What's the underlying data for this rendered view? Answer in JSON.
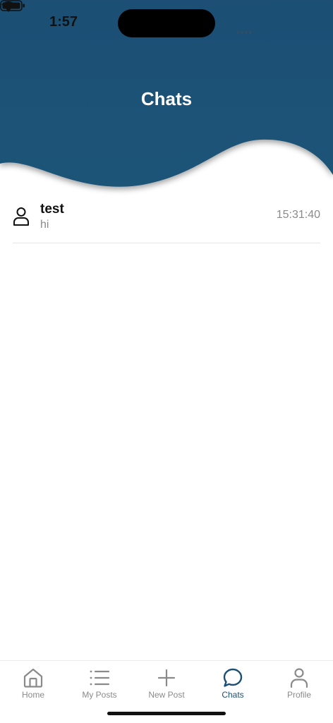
{
  "status_bar": {
    "time": "1:57"
  },
  "header": {
    "title": "Chats",
    "bg_color": "#1c4f73"
  },
  "chats": [
    {
      "name": "test",
      "preview": "hi",
      "time": "15:31:40",
      "avatar_icon": "person-outline-icon"
    }
  ],
  "tab_bar": {
    "active_color": "#1c4f73",
    "inactive_color": "#8a8a8a",
    "tabs": [
      {
        "label": "Home",
        "icon": "home-icon",
        "active": false
      },
      {
        "label": "My Posts",
        "icon": "list-icon",
        "active": false
      },
      {
        "label": "New Post",
        "icon": "plus-icon",
        "active": false
      },
      {
        "label": "Chats",
        "icon": "chat-bubble-icon",
        "active": true
      },
      {
        "label": "Profile",
        "icon": "person-icon",
        "active": false
      }
    ]
  }
}
